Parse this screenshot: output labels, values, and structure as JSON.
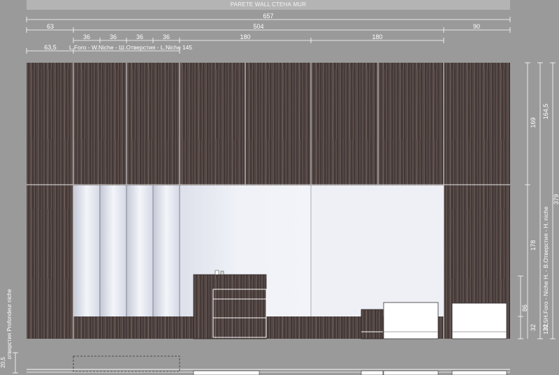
{
  "title": "PARETE WALL СТЕНА MUR",
  "dimensions": {
    "top": {
      "overall": "657",
      "left_margin": "63",
      "middle": "504",
      "right_margin": "90",
      "sub_36_a": "36",
      "sub_36_b": "36",
      "sub_36_c": "36",
      "sub_36_d": "36",
      "sub_180_a": "180",
      "sub_180_b": "180",
      "niche_offset": "63,5",
      "niche_label": "L.Foro - W.Niche - Ш.Отверстия - L.Niche 145"
    },
    "right": {
      "upper": "169",
      "upper_alt": "164,5",
      "total": "379",
      "niche_height": "178",
      "niche_height_label": "179,5H.Foro - Niche H. - В.Отверстия - H. niche",
      "low_cabinet": "86",
      "plinth_a": "32",
      "plinth_b": "32"
    },
    "left": {
      "depth_value": "20,5",
      "depth_label": "отверстия Profondeur niche"
    }
  },
  "colors": {
    "background": "#9a9a9a",
    "wood": "#4a3e3c",
    "niche_light": "#f0f2f8",
    "niche_shadow": "#bcc2d2",
    "white_unit": "#ffffff",
    "dimension_line": "#ffffff"
  }
}
